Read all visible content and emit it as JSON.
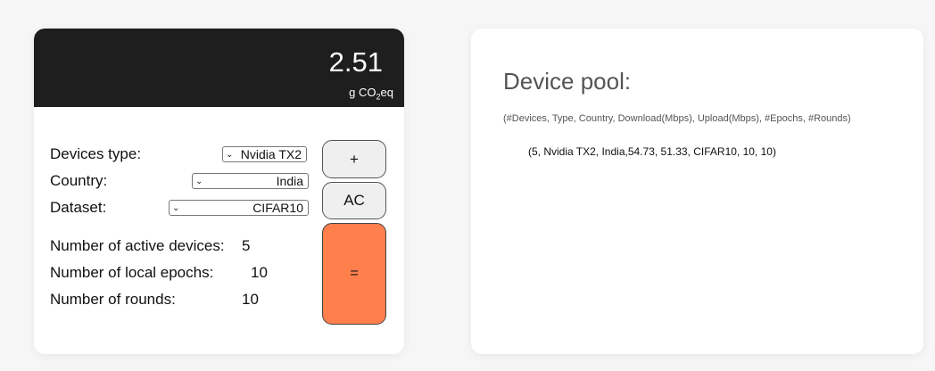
{
  "display": {
    "value": "2.51",
    "unit_prefix": "g CO",
    "unit_sub": "2",
    "unit_suffix": "eq"
  },
  "form": {
    "device_type_label": "Devices type:",
    "device_type_value": "Nvidia TX2",
    "country_label": "Country:",
    "country_value": "India",
    "dataset_label": "Dataset:",
    "dataset_value": "CIFAR10"
  },
  "stats": {
    "active_devices_label": "Number of active devices:",
    "active_devices_value": "5",
    "local_epochs_label": "Number of local epochs:",
    "local_epochs_value": "10",
    "rounds_label": "Number of rounds:",
    "rounds_value": "10"
  },
  "buttons": {
    "add_label": "+",
    "clear_label": "AC",
    "equals_label": "="
  },
  "pool": {
    "title": "Device pool:",
    "columns": "(#Devices, Type, Country, Download(Mbps), Upload(Mbps), #Epochs, #Rounds)",
    "entries": [
      "(5, Nvidia TX2, India,54.73, 51.33, CIFAR10, 10, 10)"
    ]
  },
  "colors": {
    "display_bg": "#1e1e1e",
    "equals_button": "#ff7f4d"
  }
}
